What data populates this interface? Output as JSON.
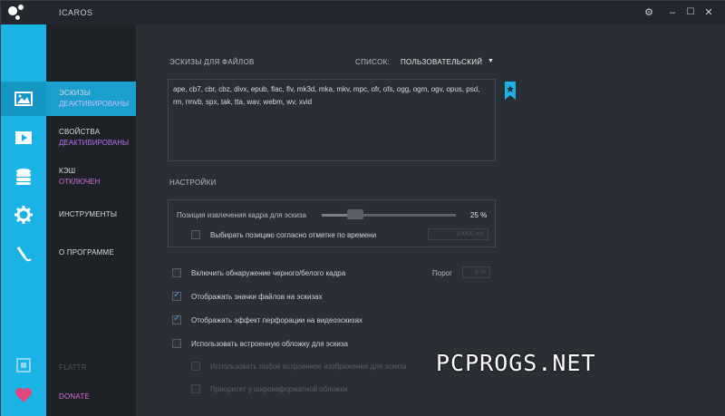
{
  "app": {
    "title": "ICAROS"
  },
  "window_controls": {
    "settings": "⚙",
    "minimize": "–",
    "maximize": "☐",
    "close": "✕"
  },
  "nav": {
    "items": [
      {
        "label": "ЭСКИЗЫ",
        "sub": "ДЕАКТИВИРОВАНЫ"
      },
      {
        "label": "СВОЙСТВА",
        "sub": "ДЕАКТИВИРОВАНЫ"
      },
      {
        "label": "КЭШ",
        "sub": "ОТКЛЮЧЕН"
      },
      {
        "label": "ИНСТРУМЕНТЫ",
        "sub": ""
      },
      {
        "label": "О ПРОГРАММЕ",
        "sub": ""
      }
    ],
    "flattr": "FLATTR",
    "donate": "DONATE"
  },
  "thumbnails": {
    "section_label": "ЭСКИЗЫ ДЛЯ ФАЙЛОВ",
    "list_label": "СПИСОК:",
    "list_value": "ПОЛЬЗОВАТЕЛЬСКИЙ",
    "extensions": "ape, cb7, cbr, cbz, divx, epub, flac, flv, mk3d, mka, mkv, mpc, ofr, ofs, ogg, ogm, ogv, opus, psd, rm, rmvb, spx, tak, tta, wav, webm, wv, xvid"
  },
  "settings": {
    "section_label": "НАСТРОЙКИ",
    "frame_position_label": "Позиция извлечения кадра для эскиза",
    "frame_position_value": "25 %",
    "frame_position_fraction": 0.25,
    "timestamp_label": "Выбирать позицию согласно отметке по времени",
    "timestamp_value": "10000 ms",
    "black_white_label": "Включить обнаружение черного/белого кадра",
    "threshold_label": "Порог",
    "threshold_value": "5 %",
    "file_icons_label": "Отображать значки файлов на эскизах",
    "perforation_label": "Отображать эффект перфорации на видеоэскизах",
    "embedded_cover_label": "Использовать встроенную обложку для эскиза",
    "any_embedded_label": "Использовать любое встроенное изображение для эскиза",
    "widescreen_label": "Приоритет у широкоформатной обложки"
  },
  "watermark": "PCPROGS.NET",
  "colors": {
    "accent": "#1ab3e6",
    "active_nav": "#1a9fce",
    "status_purple": "#b66cf0",
    "donate_heart": "#e0457b"
  }
}
